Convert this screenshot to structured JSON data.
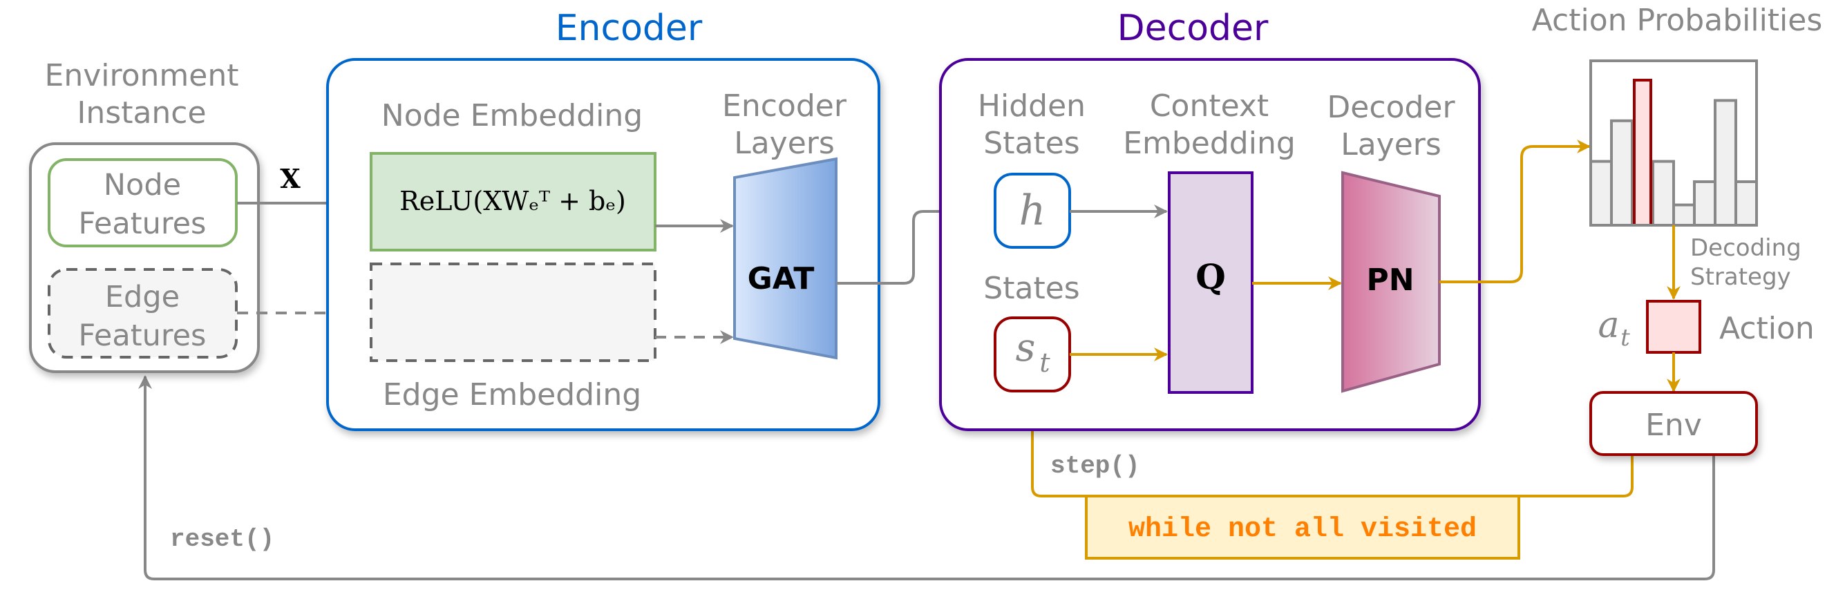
{
  "colors": {
    "encoder": "#0066CC",
    "decoder": "#4C0099",
    "gray_line": "#888888",
    "gold_line": "#D79B00",
    "node_green_stroke": "#82B366",
    "node_green_fill": "#D5E8D4",
    "red_stroke": "#990000",
    "red_fill": "#FFE0E0",
    "loop_fill": "#FFF2CC",
    "loop_text": "#FF8000"
  },
  "environment": {
    "title_line1": "Environment",
    "title_line2": "Instance",
    "node_features_line1": "Node",
    "node_features_line2": "Features",
    "edge_features_line1": "Edge",
    "edge_features_line2": "Features",
    "x_label": "X"
  },
  "encoder": {
    "title": "Encoder",
    "node_embedding_label": "Node Embedding",
    "node_embedding_formula": "ReLU(XWₑᵀ + bₑ)",
    "edge_embedding_label": "Edge Embedding",
    "layers_label_line1": "Encoder",
    "layers_label_line2": "Layers",
    "gat_label": "GAT"
  },
  "decoder": {
    "title": "Decoder",
    "hidden_states_line1": "Hidden",
    "hidden_states_line2": "States",
    "hidden_symbol": "h",
    "states_label": "States",
    "state_symbol": "s",
    "state_subscript": "t",
    "context_line1": "Context",
    "context_line2": "Embedding",
    "context_symbol": "Q",
    "layers_line1": "Decoder",
    "layers_line2": "Layers",
    "pn_label": "PN"
  },
  "action": {
    "probabilities_title": "Action Probabilities",
    "bars": [
      0.44,
      0.72,
      1.0,
      0.44,
      0.14,
      0.3,
      0.86,
      0.3
    ],
    "selected_index": 2,
    "decoding_line1": "Decoding",
    "decoding_line2": "Strategy",
    "action_symbol": "a",
    "action_subscript": "t",
    "action_label": "Action",
    "env_label": "Env"
  },
  "loop": {
    "step_label": "step()",
    "reset_label": "reset()",
    "while_label": "while not all visited"
  }
}
